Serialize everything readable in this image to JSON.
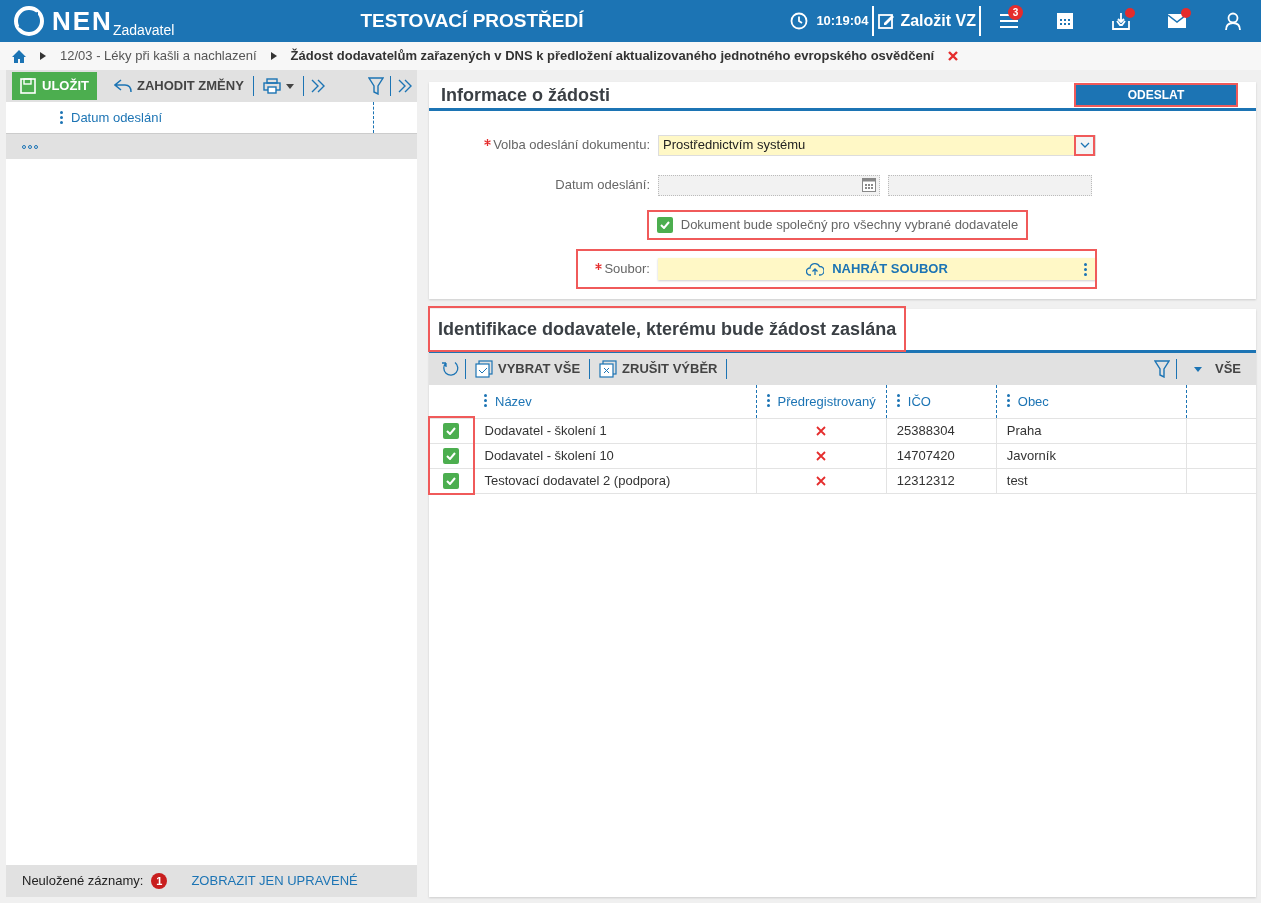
{
  "header": {
    "logo": "NEN",
    "subtitle": "Zadavatel",
    "env_title": "TESTOVACÍ PROSTŘEDÍ",
    "time": "10:19:04",
    "create_button": "Založit VZ",
    "menu_badge": "3",
    "inbox_notification": true,
    "mail_notification": true
  },
  "breadcrumb": {
    "items": [
      "12/03 - Léky při kašli a nachlazení",
      "Žádost dodavatelům zařazených v DNS k předložení aktualizovaného jednotného evropského osvědčení"
    ]
  },
  "left_panel": {
    "save_button": "ULOŽIT",
    "discard_button": "ZAHODIT ZMĚNY",
    "columns": [
      "Datum odeslání"
    ],
    "unsaved_label": "Neuložené záznamy:",
    "unsaved_count": "1",
    "show_edited_link": "ZOBRAZIT JEN UPRAVENÉ"
  },
  "info_section": {
    "title": "Informace o žádosti",
    "send_button": {
      "label": "ODESLAT",
      "highlighted": true
    },
    "fields": [
      {
        "kind": "select",
        "label": "Volba odeslání dokumentu:",
        "required": true,
        "value": "Prostřednictvím systému",
        "highlighted": true
      },
      {
        "kind": "date",
        "label": "Datum odeslání:",
        "required": false,
        "highlighted": false
      },
      {
        "kind": "checkbox",
        "label": "Dokument bude společný pro všechny vybrané dodavatele",
        "checked": true,
        "highlighted": true
      },
      {
        "kind": "file",
        "label": "Soubor:",
        "required": true,
        "button": "NAHRÁT SOUBOR",
        "highlighted": true
      }
    ]
  },
  "suppliers_section": {
    "title": "Identifikace dodavatele, kterému bude žádost zaslána",
    "title_highlighted": true,
    "select_all_button": "VYBRAT VŠE",
    "deselect_button": "ZRUŠIT VÝBĚR",
    "scope_button": "VŠE",
    "checkboxes_highlighted": true,
    "columns": [
      "Název",
      "Předregistrovaný",
      "IČO",
      "Obec"
    ],
    "rows": [
      {
        "selected": true,
        "name": "Dodavatel - školení 1",
        "preregistered": false,
        "ico": "25388304",
        "city": "Praha"
      },
      {
        "selected": true,
        "name": "Dodavatel - školení 10",
        "preregistered": false,
        "ico": "14707420",
        "city": "Javorník"
      },
      {
        "selected": true,
        "name": "Testovací dodavatel 2 (podpora)",
        "preregistered": false,
        "ico": "12312312",
        "city": "test"
      }
    ]
  }
}
